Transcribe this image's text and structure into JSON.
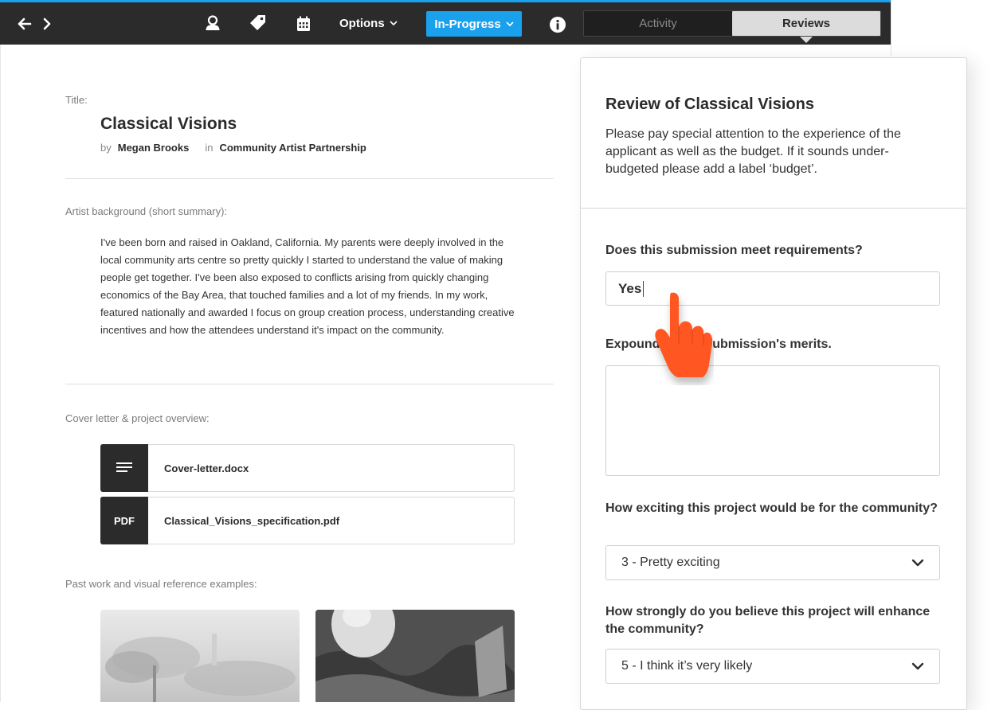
{
  "toolbar": {
    "options_label": "Options",
    "status_label": "In-Progress",
    "tabs": [
      {
        "label": "Activity",
        "active": false
      },
      {
        "label": "Reviews",
        "active": true
      }
    ],
    "accent_color": "#1aa1ee",
    "icons": [
      "arrow-left-icon",
      "arrow-right-icon",
      "user-icon",
      "tag-icon",
      "calendar-icon",
      "chevron-down-icon",
      "info-icon"
    ]
  },
  "submission": {
    "title_label": "Title:",
    "title": "Classical Visions",
    "by_label": "by",
    "author": "Megan Brooks",
    "in_label": "in",
    "program": "Community Artist Partnership",
    "background_label": "Artist background (short summary):",
    "background_text": "I've been born and raised in Oakland, California. My parents were deeply involved in the local community arts centre so pretty quickly I started to understand the value of making people get together. I've been also exposed to conflicts arising from quickly changing economics of the Bay Area, that touched families and a lot of my friends. In my work, featured nationally and awarded I focus on group creation process, understanding creative incentives and how the attendees understand it's impact on the community.",
    "cover_label": "Cover letter & project overview:",
    "files": [
      {
        "icon": "document-lines-icon",
        "type_label": "",
        "name": "Cover-letter.docx"
      },
      {
        "icon": "pdf-icon",
        "type_label": "PDF",
        "name": "Classical_Visions_specification.pdf"
      }
    ],
    "past_work_label": "Past work and visual reference examples:"
  },
  "review": {
    "title": "Review of Classical Visions",
    "description": "Please pay special attention to the experience of the applicant as well as the budget. If it sounds under-budgeted please add a label ‘budget’.",
    "q1": "Does this submission meet requirements?",
    "q1_value": "Yes",
    "q2": "Expound on the submission's merits.",
    "q2_value": "",
    "q3": "How exciting this project would be for the community?",
    "q3_value": "3 - Pretty exciting",
    "q4": "How strongly do you believe this project will enhance the community?",
    "q4_value": "5 - I think it’s very likely"
  },
  "pointer": {
    "icon": "hand-pointer-icon",
    "color": "#ff5722"
  }
}
